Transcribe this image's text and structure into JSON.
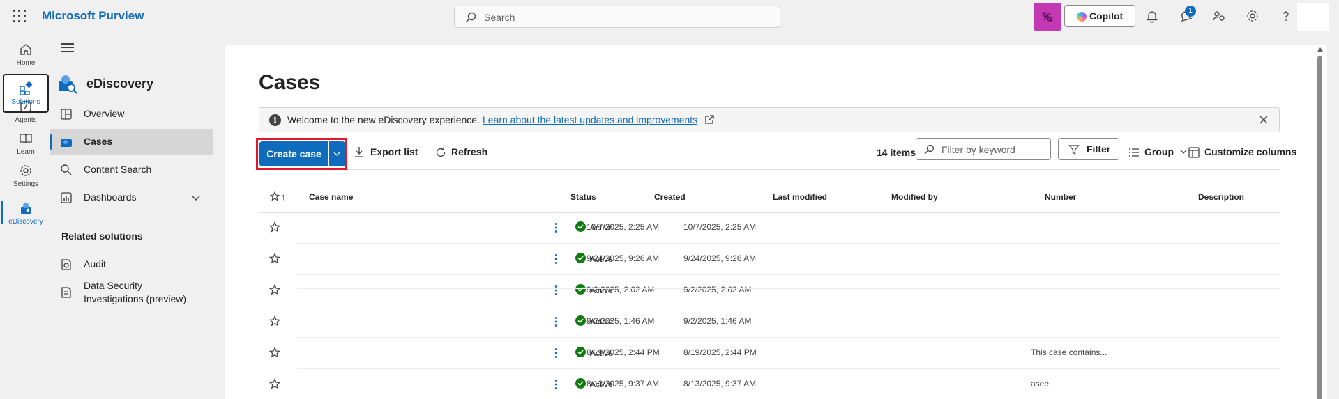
{
  "topbar": {
    "app_name": "Microsoft Purview",
    "search_placeholder": "Search",
    "copilot_label": "Copilot",
    "notification_count": "1"
  },
  "rail": {
    "items": [
      {
        "label": "Home",
        "icon": "home-icon"
      },
      {
        "label": "Solutions",
        "icon": "solutions-icon"
      },
      {
        "label": "Agents",
        "icon": "agents-icon"
      },
      {
        "label": "Learn",
        "icon": "learn-icon"
      },
      {
        "label": "Settings",
        "icon": "settings-icon"
      },
      {
        "label": "eDiscovery",
        "icon": "ediscovery-icon"
      }
    ]
  },
  "nav": {
    "title": "eDiscovery",
    "items": [
      {
        "label": "Overview",
        "icon": "overview-icon"
      },
      {
        "label": "Cases",
        "icon": "cases-icon"
      },
      {
        "label": "Content Search",
        "icon": "search-icon"
      },
      {
        "label": "Dashboards",
        "icon": "dashboards-icon"
      }
    ],
    "related_heading": "Related solutions",
    "related": [
      {
        "label": "Audit",
        "icon": "audit-icon"
      },
      {
        "label": "Data Security Investigations (preview)",
        "icon": "data-security-icon"
      }
    ]
  },
  "page": {
    "title": "Cases",
    "banner_text": "Welcome to the new eDiscovery experience.",
    "banner_link": "Learn about the latest updates and improvements"
  },
  "toolbar": {
    "create_label": "Create case",
    "export_label": "Export list",
    "refresh_label": "Refresh",
    "items_count": "14 items",
    "filter_placeholder": "Filter by keyword",
    "filter_label": "Filter",
    "group_label": "Group",
    "customize_label": "Customize columns"
  },
  "table": {
    "columns": [
      "Case name",
      "Status",
      "Created",
      "Last modified",
      "Modified by",
      "Number",
      "Description"
    ],
    "sort_indicator": "↑",
    "rows": [
      {
        "status": "Active",
        "created": "10/7/2025, 2:25 AM",
        "modified": "10/7/2025, 2:25 AM",
        "description": ""
      },
      {
        "status": "Active",
        "created": "9/24/2025, 9:26 AM",
        "modified": "9/24/2025, 9:26 AM",
        "description": ""
      },
      {
        "status": "Active",
        "created": "9/2/2025, 2:02 AM",
        "modified": "9/2/2025, 2:02 AM",
        "description": ""
      },
      {
        "status": "Active",
        "created": "9/2/2025, 1:46 AM",
        "modified": "9/2/2025, 1:46 AM",
        "description": ""
      },
      {
        "status": "Active",
        "created": "8/19/2025, 2:44 PM",
        "modified": "8/19/2025, 2:44 PM",
        "description": "This case contains..."
      },
      {
        "status": "Active",
        "created": "8/13/2025, 9:37 AM",
        "modified": "8/13/2025, 9:37 AM",
        "description": "asee"
      }
    ]
  },
  "colors": {
    "accent": "#0f6cbd",
    "highlight_border": "#e0182d",
    "status_active": "#107c10",
    "mesh_button": "#c239b3"
  }
}
